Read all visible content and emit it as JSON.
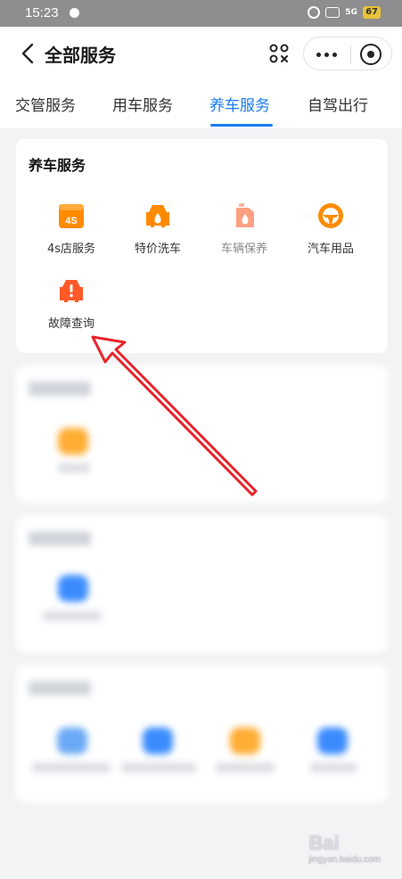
{
  "status_bar": {
    "time": "15:23",
    "battery": "67",
    "signal": "5G"
  },
  "nav": {
    "title": "全部服务"
  },
  "tabs": [
    {
      "label": "交管服务"
    },
    {
      "label": "用车服务"
    },
    {
      "label": "养车服务",
      "active": true
    },
    {
      "label": "自驾出行"
    }
  ],
  "section": {
    "title": "养车服务",
    "items": [
      {
        "label": "4s店服务",
        "icon": "store-4s-icon",
        "badge": "4S",
        "color": "#ff8a00"
      },
      {
        "label": "特价洗车",
        "icon": "car-wash-icon",
        "color": "#ff8a00"
      },
      {
        "label": "车辆保养",
        "icon": "oil-can-icon",
        "color": "#ff9f82",
        "disabled": true
      },
      {
        "label": "汽车用品",
        "icon": "steering-wheel-icon",
        "color": "#ff8a00"
      },
      {
        "label": "故障查询",
        "icon": "car-fault-icon",
        "color": "#ff5a28"
      }
    ]
  },
  "colors": {
    "accent": "#1a7cf2",
    "annotation_arrow": "#e8232a"
  },
  "watermark": {
    "line1": "Bai",
    "line2": "jingyan.baidu.com"
  }
}
